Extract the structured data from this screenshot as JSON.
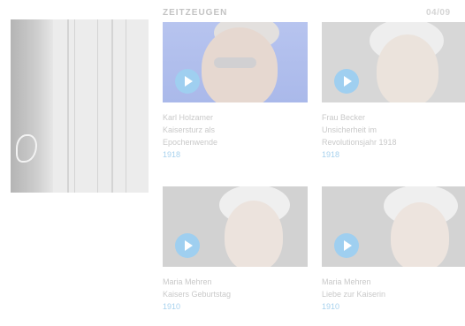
{
  "section": {
    "title": "ZEITZEUGEN",
    "pager": "04/09"
  },
  "left_film": {
    "description_icon": "film-still"
  },
  "witnesses": [
    {
      "name": "Karl Holzamer",
      "title_line1": "Kaisersturz als",
      "title_line2": "Epochenwende",
      "year": "1918",
      "play_icon": "play-icon"
    },
    {
      "name": "Frau Becker",
      "title_line1": "Unsicherheit im",
      "title_line2": "Revolutionsjahr 1918",
      "year": "1918",
      "play_icon": "play-icon"
    },
    {
      "name": "Maria Mehren",
      "title_line1": "Kaisers Geburtstag",
      "title_line2": "",
      "year": "1910",
      "play_icon": "play-icon"
    },
    {
      "name": "Maria Mehren",
      "title_line1": "Liebe zur Kaiserin",
      "title_line2": "",
      "year": "1910",
      "play_icon": "play-icon"
    }
  ],
  "colors": {
    "accent": "#9fcff0",
    "year_text": "#a8d2ee",
    "caption_text": "#c9c9c9",
    "label_text": "#c3c3c3"
  }
}
